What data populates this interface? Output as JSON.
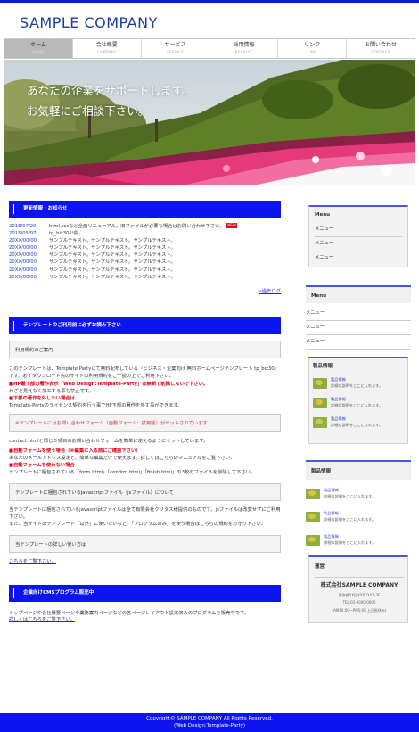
{
  "brand": {
    "logo": "SAMPLE COMPANY",
    "accent": "#0c14f0",
    "logo_color": "#1a3f9a"
  },
  "nav": [
    {
      "jp": "ホーム",
      "en": "HOME",
      "active": true
    },
    {
      "jp": "会社概要",
      "en": "COMPANY"
    },
    {
      "jp": "サービス",
      "en": "SERVICE"
    },
    {
      "jp": "採用情報",
      "en": "RECRUIT"
    },
    {
      "jp": "リンク",
      "en": "LINK"
    },
    {
      "jp": "お問い合わせ",
      "en": "CONTACT"
    }
  ],
  "hero": {
    "line1": "あなたの企業をサポートします。",
    "line2": "お気軽にご相談下さい。"
  },
  "news": {
    "title": "更新情報・お知らせ",
    "items": [
      {
        "date": "2018/07/20",
        "text": "html,cssなど全面リニューアル。旧ファイルが必要な場合はお問い合わせ下さい。",
        "badge": "NEW"
      },
      {
        "date": "2015/05/07",
        "text": "tp_biz30公開。"
      },
      {
        "date": "20XX/00/00",
        "text": "サンプルテキスト。サンプルテキスト。サンプルテキスト。"
      },
      {
        "date": "20XX/00/00",
        "text": "サンプルテキスト。サンプルテキスト。サンプルテキスト。"
      },
      {
        "date": "20XX/00/00",
        "text": "サンプルテキスト。サンプルテキスト。サンプルテキスト。"
      },
      {
        "date": "20XX/00/00",
        "text": "サンプルテキスト。サンプルテキスト。サンプルテキスト。"
      },
      {
        "date": "20XX/00/00",
        "text": "サンプルテキスト。サンプルテキスト。サンプルテキスト。"
      },
      {
        "date": "20XX/00/00",
        "text": "サンプルテキスト。サンプルテキスト。サンプルテキスト。"
      }
    ],
    "more": "»過去ログ"
  },
  "guide": {
    "title": "テンプレートのご利用前に必ずお読み下さい",
    "box1": "利用規約のご案内",
    "p1": "このテンプレートは、Template Partyにて無料配布している『ビジネス・企業向け 無料ホームページテンプレート tp_biz30』です。必ずダウンロード先のサイトの利用規約をご一読の上でご利用下さい。",
    "r1": "■HP最下部の著作表示「Web Design:Template-Party」は無断で削除しないで下さい。",
    "p2": "わざと見えなく加工する事も禁止です。",
    "r2": "■下部の著作を外したい場合は",
    "p3": "Template-Partyのライセンス契約を行う事でHP下部の著作を外す事ができます。",
    "box2": "※テンプレートにはお問い合わせフォーム（自動フォーム：試用版）がセットされています",
    "p4": "contact.htmlと同じ３項目のお問い合わせフォームを簡単に使えるようにセットしています。",
    "r3": "■自動フォームを使う場合（※編集に入る前にご確認下さい）",
    "p5": "あなたのメールアドレス設定と、簡単な編集だけで使えます。詳しくはこちらのマニュアルをご覧下さい。",
    "r4": "■自動フォームを使わない場合",
    "p6": "テンプレートに梱包されている「form.html」「confirm.html」「finish.html」の3枚のファイルを削除して下さい。",
    "box3": "テンプレートに梱包されているjavascriptファイル（jsファイル）について",
    "p7": "当テンプレートに梱包されているjavascriptファイルは全て有限会社クリタス様提供のものです。jsファイルは改変せずにご利用下さい。",
    "p8": "また、当サイトのテンプレート「以外」に使いたいなど、「プログラムのみ」を使う場合はこちらの規約をお守り下さい。",
    "box4": "当テンプレートの詳しい使い方は",
    "link": "こちらをご覧下さい。"
  },
  "cms": {
    "title": "企業向けCMSプログラム販売中",
    "p": "トップページや会社概要ページや業務案内ページなどの各ページレイアウト設定済みのプログラムを販売中です。",
    "link": "詳しくはこちらをご覧下さい。"
  },
  "sidebar": {
    "menu1": {
      "title": "Menu",
      "items": [
        "メニュー",
        "メニュー",
        "メニュー"
      ]
    },
    "menu2": {
      "title": "Menu",
      "items": [
        "メニュー",
        "メニュー",
        "メニュー"
      ]
    },
    "prod1": {
      "title": "製品情報",
      "items": [
        {
          "name": "製品情報",
          "desc": "詳細な説明をここに入れます。"
        },
        {
          "name": "製品情報",
          "desc": "詳細な説明をここに入れます。"
        },
        {
          "name": "製品情報",
          "desc": "詳細な説明をここに入れます。"
        }
      ]
    },
    "prod2": {
      "title": "製品情報",
      "items": [
        {
          "name": "製品情報",
          "desc": "詳細な説明をここに入れます。"
        },
        {
          "name": "製品情報",
          "desc": "詳細な説明をここに入れます。"
        },
        {
          "name": "製品情報",
          "desc": "詳細な説明をここに入れます。"
        }
      ]
    },
    "company": {
      "title": "運営",
      "name": "株式会社SAMPLE COMPANY",
      "address": "東京都XX区XXXXXX1-3F",
      "tel": "TEL:03-0000-0000",
      "hours": "(AM10:00〜PM5:00 土日祝休み)"
    }
  },
  "footer": {
    "copyright": "Copyright© SAMPLE COMPANY All Rights Reserved.",
    "credit": "(Web Design:Template-Party)"
  }
}
